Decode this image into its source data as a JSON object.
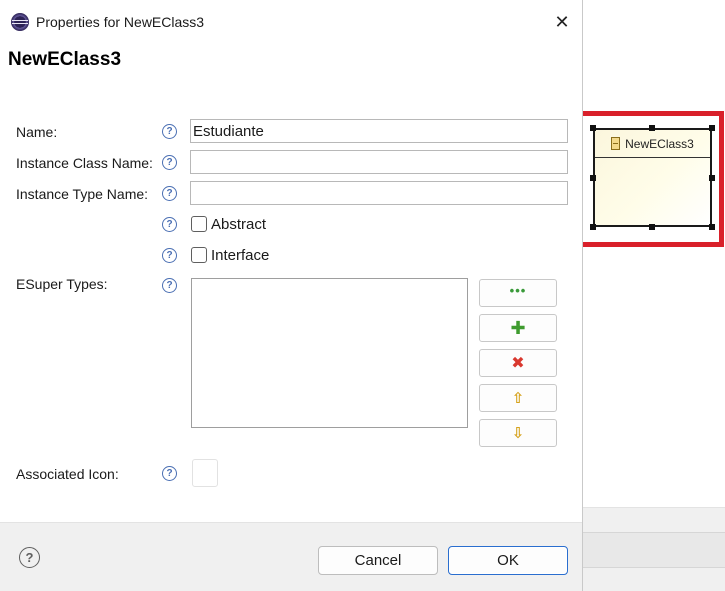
{
  "dialog": {
    "title": "Properties for NewEClass3",
    "heading": "NewEClass3",
    "close_glyph": "✕"
  },
  "form": {
    "name_label": "Name:",
    "name_value": "Estudiante",
    "instance_class_label": "Instance Class Name:",
    "instance_class_value": "",
    "instance_type_label": "Instance Type Name:",
    "instance_type_value": "",
    "abstract_label": "Abstract",
    "interface_label": "Interface",
    "esuper_types_label": "ESuper Types:",
    "associated_icon_label": "Associated Icon:",
    "help_glyph": "?"
  },
  "esuper_buttons": {
    "browse_glyph": "•••",
    "add_glyph": "✚",
    "remove_glyph": "✖",
    "up_glyph": "⇧",
    "down_glyph": "⇩"
  },
  "footer": {
    "help_glyph": "?",
    "cancel_label": "Cancel",
    "ok_label": "OK"
  },
  "diagram": {
    "eclass_name": "NewEClass3",
    "highlight_color": "#d9202a"
  },
  "colors": {
    "ok_border": "#2a6ecf",
    "help_icon": "#4a6fb3"
  }
}
